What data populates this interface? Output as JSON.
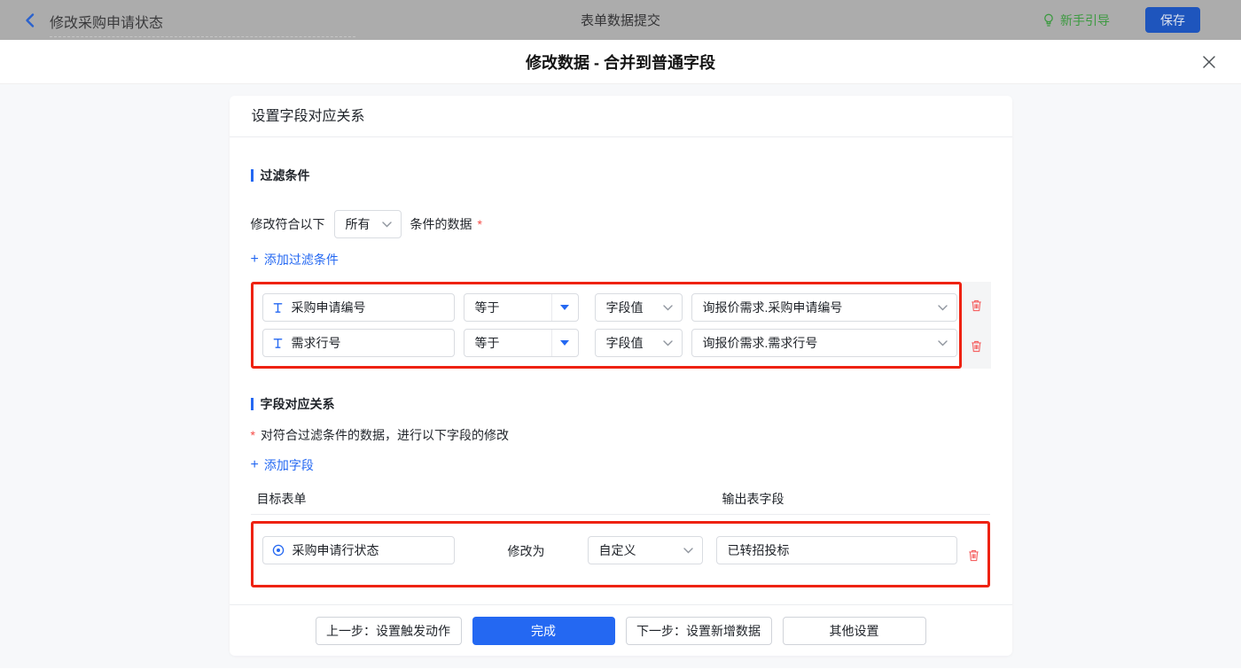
{
  "topbar": {
    "back_title": "修改采购申请状态",
    "center_title": "表单数据提交",
    "guide_label": "新手引导",
    "save_label": "保存"
  },
  "modal": {
    "title": "修改数据 - 合并到普通字段",
    "panel_title": "设置字段对应关系",
    "filter_section": {
      "title": "过滤条件",
      "match_prefix": "修改符合以下",
      "match_mode": "所有",
      "match_suffix": "条件的数据",
      "required_mark": "*",
      "add_label": "添加过滤条件",
      "rows": [
        {
          "field": "采购申请编号",
          "operator": "等于",
          "value_type": "字段值",
          "value": "询报价需求.采购申请编号"
        },
        {
          "field": "需求行号",
          "operator": "等于",
          "value_type": "字段值",
          "value": "询报价需求.需求行号"
        }
      ]
    },
    "mapping_section": {
      "title": "字段对应关系",
      "required_mark": "*",
      "description": "对符合过滤条件的数据，进行以下字段的修改",
      "add_label": "添加字段",
      "col_target": "目标表单",
      "col_output": "输出表字段",
      "rows": [
        {
          "field": "采购申请行状态",
          "action_label": "修改为",
          "value_mode": "自定义",
          "value": "已转招投标"
        }
      ]
    },
    "footer": {
      "prev_label": "上一步：设置触发动作",
      "done_label": "完成",
      "next_label": "下一步：设置新增数据",
      "other_label": "其他设置"
    }
  },
  "icons": {
    "plus": "+"
  },
  "colors": {
    "accent_blue": "#2468f2",
    "highlight_red": "#ee2211",
    "trash_red": "#f56262",
    "guide_green": "#3c9a40",
    "topbar_dimmed_bg": "#acacac",
    "save_dimmed_blue": "#1e55bd",
    "page_bg": "#f7f8fa"
  }
}
